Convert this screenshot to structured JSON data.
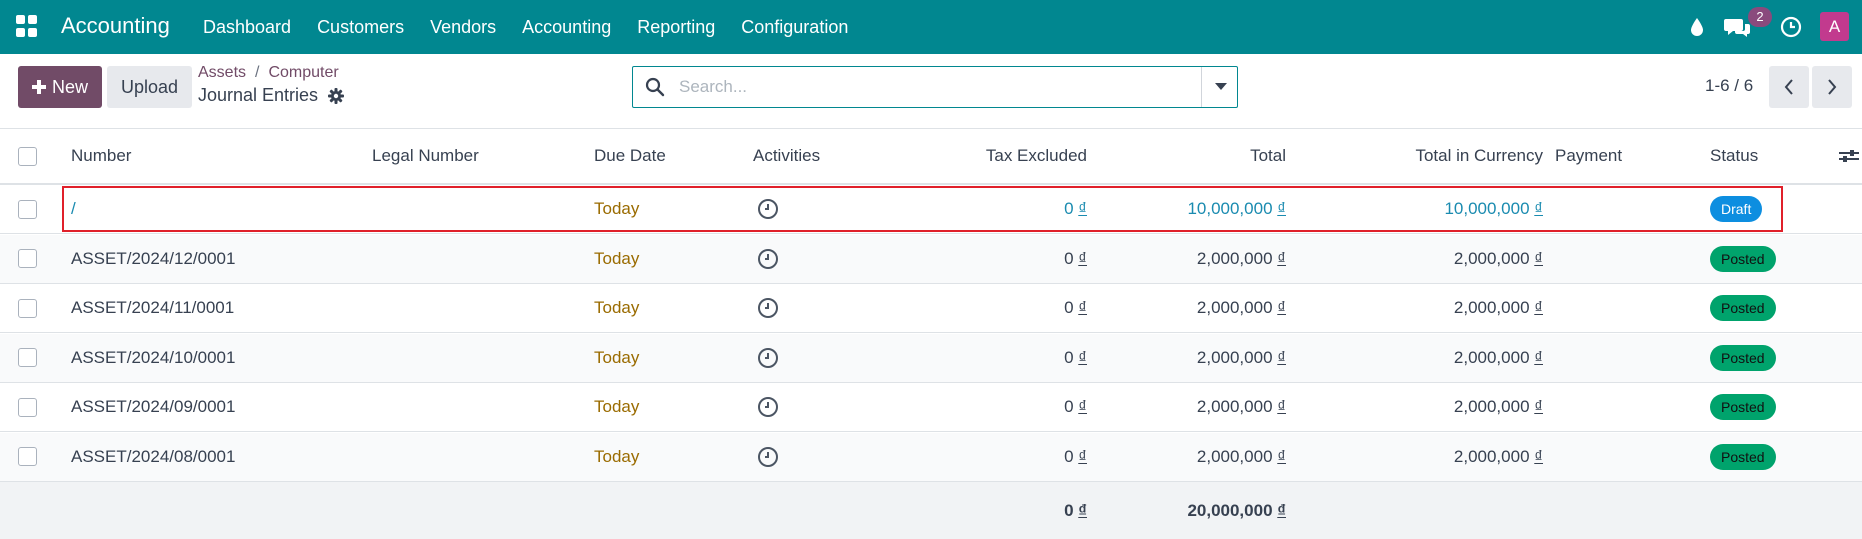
{
  "navbar": {
    "brand": "Accounting",
    "menu": [
      "Dashboard",
      "Customers",
      "Vendors",
      "Accounting",
      "Reporting",
      "Configuration"
    ],
    "message_count": "2",
    "avatar_letter": "A"
  },
  "controls": {
    "new_label": "New",
    "upload_label": "Upload",
    "breadcrumb": [
      "Assets",
      "Computer"
    ],
    "page_title": "Journal Entries",
    "search_placeholder": "Search...",
    "pager": "1-6 / 6"
  },
  "table": {
    "columns": [
      "Number",
      "Legal Number",
      "Due Date",
      "Activities",
      "Tax Excluded",
      "Total",
      "Total in Currency",
      "Payment",
      "Status"
    ],
    "currency_symbol": "₫",
    "rows": [
      {
        "number": "/",
        "legal": "",
        "due": "Today",
        "tax": "0",
        "total": "10,000,000",
        "total_cur": "10,000,000",
        "payment": "",
        "status": "Draft"
      },
      {
        "number": "ASSET/2024/12/0001",
        "legal": "",
        "due": "Today",
        "tax": "0",
        "total": "2,000,000",
        "total_cur": "2,000,000",
        "payment": "",
        "status": "Posted"
      },
      {
        "number": "ASSET/2024/11/0001",
        "legal": "",
        "due": "Today",
        "tax": "0",
        "total": "2,000,000",
        "total_cur": "2,000,000",
        "payment": "",
        "status": "Posted"
      },
      {
        "number": "ASSET/2024/10/0001",
        "legal": "",
        "due": "Today",
        "tax": "0",
        "total": "2,000,000",
        "total_cur": "2,000,000",
        "payment": "",
        "status": "Posted"
      },
      {
        "number": "ASSET/2024/09/0001",
        "legal": "",
        "due": "Today",
        "tax": "0",
        "total": "2,000,000",
        "total_cur": "2,000,000",
        "payment": "",
        "status": "Posted"
      },
      {
        "number": "ASSET/2024/08/0001",
        "legal": "",
        "due": "Today",
        "tax": "0",
        "total": "2,000,000",
        "total_cur": "2,000,000",
        "payment": "",
        "status": "Posted"
      }
    ],
    "footer": {
      "tax": "0",
      "total": "20,000,000"
    }
  },
  "colors": {
    "navbar": "#018790",
    "primary": "#714b67",
    "posted": "#00a36c",
    "draft": "#0d8ee0",
    "highlight": "#e0202a"
  }
}
